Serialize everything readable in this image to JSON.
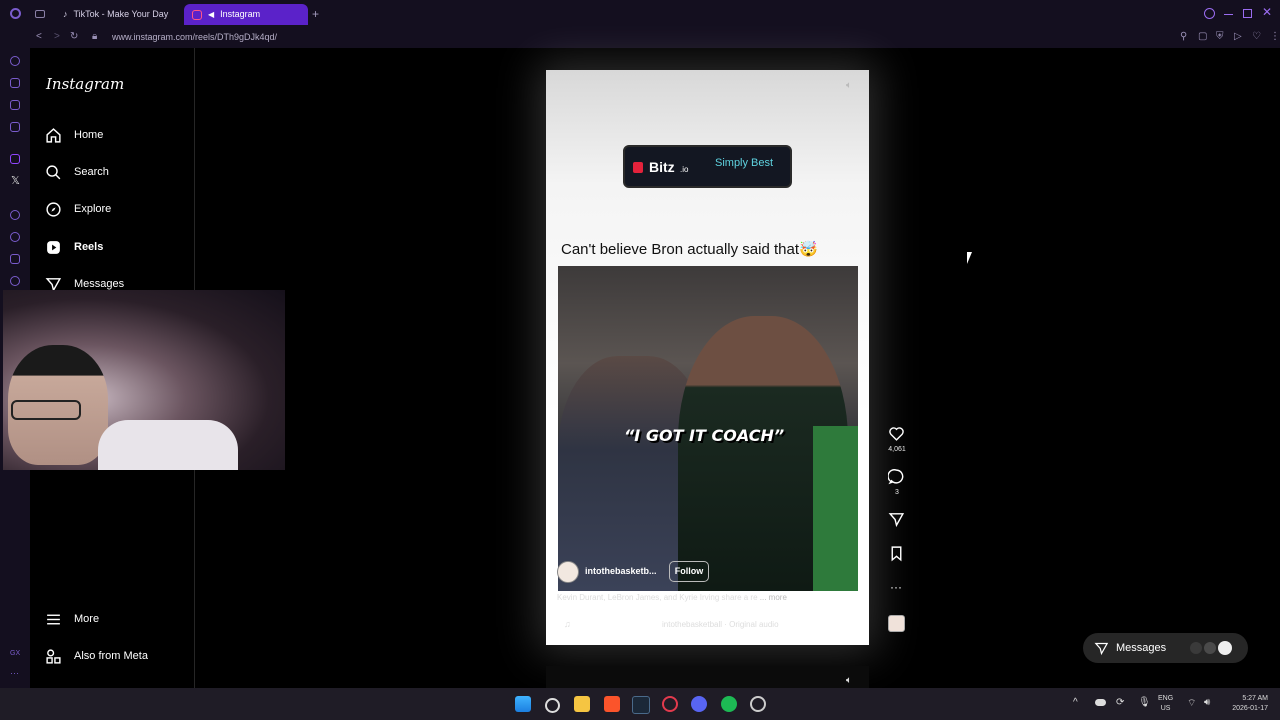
{
  "browser": {
    "tabs": [
      {
        "label": "TikTok - Make Your Day",
        "active": false
      },
      {
        "label": "Instagram",
        "active": true
      }
    ],
    "url": "www.instagram.com/reels/DTh9gDJk4qd/"
  },
  "sidebar": {
    "logo": "Instagram",
    "items": [
      {
        "label": "Home",
        "icon": "home-icon"
      },
      {
        "label": "Search",
        "icon": "search-icon"
      },
      {
        "label": "Explore",
        "icon": "compass-icon"
      },
      {
        "label": "Reels",
        "icon": "reels-icon"
      },
      {
        "label": "Messages",
        "icon": "messages-icon"
      }
    ],
    "more_label": "More",
    "meta_label": "Also from Meta"
  },
  "reel": {
    "ad_brand": "Bitz",
    "ad_brand_suffix": ".io",
    "ad_tagline": "Simply Best",
    "headline": "Can't believe Bron actually said that🤯",
    "video_caption": "“I GOT IT COACH”",
    "username": "intothebasketb...",
    "follow_label": "Follow",
    "description": "Kevin Durant, LeBron James, and Kyrie Irving share a re",
    "more_label": "... more",
    "audio": "intothebasketball · Original audio"
  },
  "actions": {
    "likes": "4,061",
    "comments": "3"
  },
  "messages_pill": {
    "label": "Messages"
  },
  "taskbar": {
    "lang": "ENG",
    "region": "US",
    "time": "5:27 AM",
    "date": "2026-01-17"
  },
  "colors": {
    "accent": "#5b22c9",
    "chrome": "#140f1f"
  }
}
